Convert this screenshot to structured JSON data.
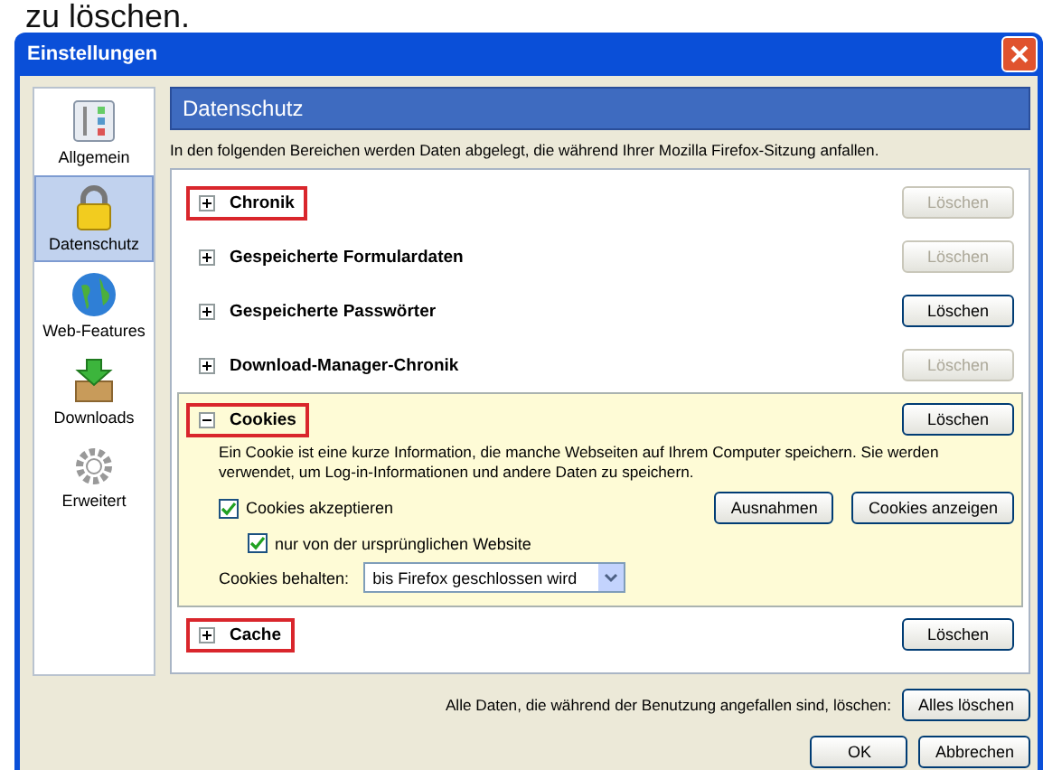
{
  "caption": "zu löschen.",
  "window": {
    "title": "Einstellungen"
  },
  "sidebar": {
    "items": [
      {
        "label": "Allgemein",
        "selected": false
      },
      {
        "label": "Datenschutz",
        "selected": true
      },
      {
        "label": "Web-Features",
        "selected": false
      },
      {
        "label": "Downloads",
        "selected": false
      },
      {
        "label": "Erweitert",
        "selected": false
      }
    ]
  },
  "panel": {
    "title": "Datenschutz",
    "description": "In den folgenden Bereichen werden Daten abgelegt, die während Ihrer Mozilla Firefox-Sitzung anfallen.",
    "sections": [
      {
        "label": "Chronik",
        "expanded": false,
        "highlighted": true,
        "button": {
          "label": "Löschen",
          "disabled": true
        }
      },
      {
        "label": "Gespeicherte Formulardaten",
        "expanded": false,
        "highlighted": false,
        "button": {
          "label": "Löschen",
          "disabled": true
        }
      },
      {
        "label": "Gespeicherte Passwörter",
        "expanded": false,
        "highlighted": false,
        "button": {
          "label": "Löschen",
          "disabled": false
        }
      },
      {
        "label": "Download-Manager-Chronik",
        "expanded": false,
        "highlighted": false,
        "button": {
          "label": "Löschen",
          "disabled": true
        }
      },
      {
        "label": "Cookies",
        "expanded": true,
        "highlighted": true,
        "button": {
          "label": "Löschen",
          "disabled": false
        },
        "details": {
          "text": "Ein Cookie ist eine kurze Information, die manche Webseiten auf Ihrem Computer speichern. Sie werden verwendet, um Log-in-Informationen und andere Daten zu speichern.",
          "checkboxes": [
            {
              "label": "Cookies akzeptieren",
              "checked": true
            },
            {
              "label": "nur von der ursprünglichen Website",
              "checked": true
            }
          ],
          "buttons": [
            "Ausnahmen",
            "Cookies anzeigen"
          ],
          "keep_label": "Cookies behalten:",
          "keep_value": "bis Firefox geschlossen wird"
        }
      },
      {
        "label": "Cache",
        "expanded": false,
        "highlighted": true,
        "button": {
          "label": "Löschen",
          "disabled": false
        }
      }
    ],
    "clear_all_text": "Alle Daten, die während der Benutzung angefallen sind, löschen:",
    "clear_all_button": "Alles löschen"
  },
  "buttons": [
    "OK",
    "Abbrechen"
  ]
}
